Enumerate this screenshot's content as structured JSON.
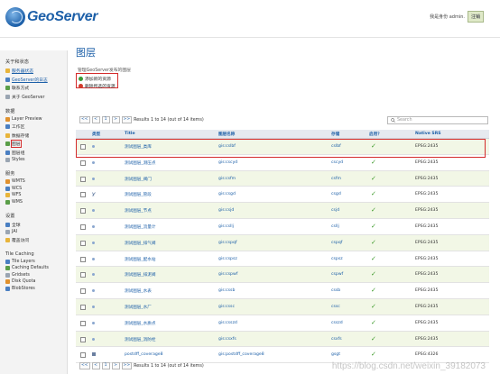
{
  "app": {
    "logo_text": "GeoServer"
  },
  "login": {
    "text": "我是身份 admin.",
    "button": "注销"
  },
  "sidebar": {
    "groups": [
      {
        "title": "关于和状态",
        "items": [
          {
            "label": "服务器状态",
            "icon": "server-status-icon",
            "link": true
          },
          {
            "label": "GeoServer的日志",
            "icon": "log-icon",
            "link": true
          },
          {
            "label": "联系方式",
            "icon": "contact-icon",
            "link": false
          },
          {
            "label": "关于 GeoServer",
            "icon": "about-icon",
            "link": false
          }
        ]
      },
      {
        "title": "数据",
        "items": [
          {
            "label": "Layer Preview",
            "icon": "layer-preview-icon",
            "link": false
          },
          {
            "label": "工作区",
            "icon": "workspace-icon",
            "link": false
          },
          {
            "label": "数据存储",
            "icon": "datastore-icon",
            "link": false
          },
          {
            "label": "图层",
            "icon": "layers-icon",
            "link": false,
            "active": true
          },
          {
            "label": "图层组",
            "icon": "layergroup-icon",
            "link": false
          },
          {
            "label": "Styles",
            "icon": "styles-icon",
            "link": false
          }
        ]
      },
      {
        "title": "服务",
        "items": [
          {
            "label": "WMTS",
            "icon": "wmts-icon",
            "link": false
          },
          {
            "label": "WCS",
            "icon": "wcs-icon",
            "link": false
          },
          {
            "label": "WFS",
            "icon": "wfs-icon",
            "link": false
          },
          {
            "label": "WMS",
            "icon": "wms-icon",
            "link": false
          }
        ]
      },
      {
        "title": "设置",
        "items": [
          {
            "label": "全球",
            "icon": "global-icon",
            "link": false
          },
          {
            "label": "JAI",
            "icon": "jai-icon",
            "link": false
          },
          {
            "label": "覆盖访问",
            "icon": "coverage-access-icon",
            "link": false
          }
        ]
      },
      {
        "title": "Tile Caching",
        "items": [
          {
            "label": "Tile Layers",
            "icon": "tile-layers-icon",
            "link": false
          },
          {
            "label": "Caching Defaults",
            "icon": "caching-defaults-icon",
            "link": false
          },
          {
            "label": "Gridsets",
            "icon": "gridsets-icon",
            "link": false
          },
          {
            "label": "Disk Quota",
            "icon": "disk-quota-icon",
            "link": false
          },
          {
            "label": "BlobStores",
            "icon": "blobstores-icon",
            "link": false
          }
        ]
      }
    ]
  },
  "page": {
    "title": "图层",
    "description": "管理GeoServer发布的图层",
    "add_label": "添加新的资源",
    "remove_label": "删除所选的资源"
  },
  "pager": {
    "first": "<<",
    "prev": "<",
    "page": "1",
    "next": ">",
    "last": ">>",
    "summary": "Results 1 to 14 (out of 14 items)"
  },
  "search": {
    "placeholder": "Search"
  },
  "table": {
    "headers": [
      "类型",
      "Title",
      "图层名称",
      "存储",
      "启用？",
      "Native SRS"
    ],
    "rows": [
      {
        "type": "polygon",
        "title": "测试图层_类库",
        "name": "gis:cslbf",
        "store": "cslbf",
        "enabled": "✓",
        "srs": "EPSG:2435"
      },
      {
        "type": "polygon",
        "title": "测试图层_测压点",
        "name": "gis:cscyd",
        "store": "cscyd",
        "enabled": "✓",
        "srs": "EPSG:2435"
      },
      {
        "type": "polygon",
        "title": "测试图层_阀门",
        "name": "gis:csfm",
        "store": "csfm",
        "enabled": "✓",
        "srs": "EPSG:2435"
      },
      {
        "type": "line",
        "title": "测试图层_管段",
        "name": "gis:csgd",
        "store": "csgd",
        "enabled": "✓",
        "srs": "EPSG:2435"
      },
      {
        "type": "polygon",
        "title": "测试图层_节点",
        "name": "gis:csjd",
        "store": "csjd",
        "enabled": "✓",
        "srs": "EPSG:2435"
      },
      {
        "type": "polygon",
        "title": "测试图层_流量计",
        "name": "gis:csllj",
        "store": "csllj",
        "enabled": "✓",
        "srs": "EPSG:2435"
      },
      {
        "type": "polygon",
        "title": "测试图层_排气阀",
        "name": "gis:cspqf",
        "store": "cspqf",
        "enabled": "✓",
        "srs": "EPSG:2435"
      },
      {
        "type": "polygon",
        "title": "测试图层_配水站",
        "name": "gis:cspsz",
        "store": "cspsz",
        "enabled": "✓",
        "srs": "EPSG:2435"
      },
      {
        "type": "polygon",
        "title": "测试图层_排泥阀",
        "name": "gis:cspwf",
        "store": "cspwf",
        "enabled": "✓",
        "srs": "EPSG:2435"
      },
      {
        "type": "polygon",
        "title": "测试图层_水表",
        "name": "gis:cssb",
        "store": "cssb",
        "enabled": "✓",
        "srs": "EPSG:2435"
      },
      {
        "type": "polygon",
        "title": "测试图层_水厂",
        "name": "gis:cssc",
        "store": "cssc",
        "enabled": "✓",
        "srs": "EPSG:2435"
      },
      {
        "type": "polygon",
        "title": "测试图层_水质点",
        "name": "gis:csszd",
        "store": "csszd",
        "enabled": "✓",
        "srs": "EPSG:2435"
      },
      {
        "type": "polygon",
        "title": "测试图层_消防栓",
        "name": "gis:csxfs",
        "store": "csxfs",
        "enabled": "✓",
        "srs": "EPSG:2435"
      },
      {
        "type": "raster",
        "title": "postdff_coverage8",
        "name": "gis:postdff_coverage8",
        "store": "gsgt",
        "enabled": "✓",
        "srs": "EPSG:4326"
      }
    ]
  },
  "watermark": "https://blog.csdn.net/weixin_39182073",
  "colors": {
    "accent": "#1c5fa8",
    "highlight_box": "#d42b2b",
    "row_alt": "#f2f7e6",
    "check": "#3f9b2c"
  }
}
